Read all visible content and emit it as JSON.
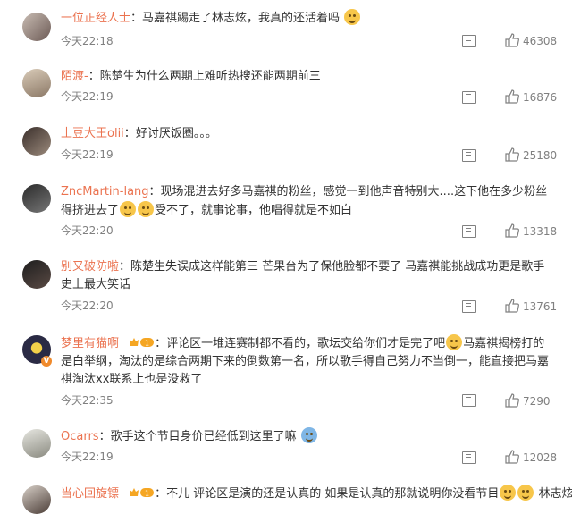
{
  "comments": [
    {
      "user": "一位正经人士",
      "text": "马嘉祺踢走了林志炫，我真的还活着吗",
      "time": "今天22:18",
      "likes": "46308"
    },
    {
      "user": "陌渡-",
      "text": "陈楚生为什么两期上难听热搜还能两期前三",
      "time": "今天22:19",
      "likes": "16876"
    },
    {
      "user": "土豆大王olii",
      "text": "好讨厌饭圈。。。",
      "time": "今天22:19",
      "likes": "25180"
    },
    {
      "user": "ZncMartin-lang",
      "text_a": "现场混进去好多马嘉祺的粉丝，感觉一到他声音特别大....这下他在多少粉丝得挤进去了",
      "text_b": "受不了，就事论事，他唱得就是不如白",
      "time": "今天22:20",
      "likes": "13318"
    },
    {
      "user": "别又破防啦",
      "text": "陈楚生失误成这样能第三 芒果台为了保他脸都不要了 马嘉祺能挑战成功更是歌手史上最大笑话",
      "time": "今天22:20",
      "likes": "13761"
    },
    {
      "user": "梦里有猫啊",
      "badge": "1",
      "text_a": "评论区一堆连赛制都不看的，歌坛交给你们才是完了吧",
      "text_b": "马嘉祺揭榜打的是白举纲，淘汰的是综合两期下来的倒数第一名，所以歌手得自己努力不当倒一，能直接把马嘉祺淘汰xx联系上也是没救了",
      "time": "今天22:35",
      "likes": "7290"
    },
    {
      "user": "Ocarrs",
      "text": "歌手这个节目身价已经低到这里了嘛",
      "time": "今天22:19",
      "likes": "12028"
    },
    {
      "user": "当心回旋镖",
      "badge": "1",
      "text_a": "不儿 评论区是演的还是认真的 如果是认真的那就说明你没看节目",
      "text_b": "林志炫",
      "time": "",
      "likes": ""
    }
  ],
  "colors": {
    "username": "#eb7350",
    "meta": "#808080",
    "badge": "#f5a623"
  }
}
